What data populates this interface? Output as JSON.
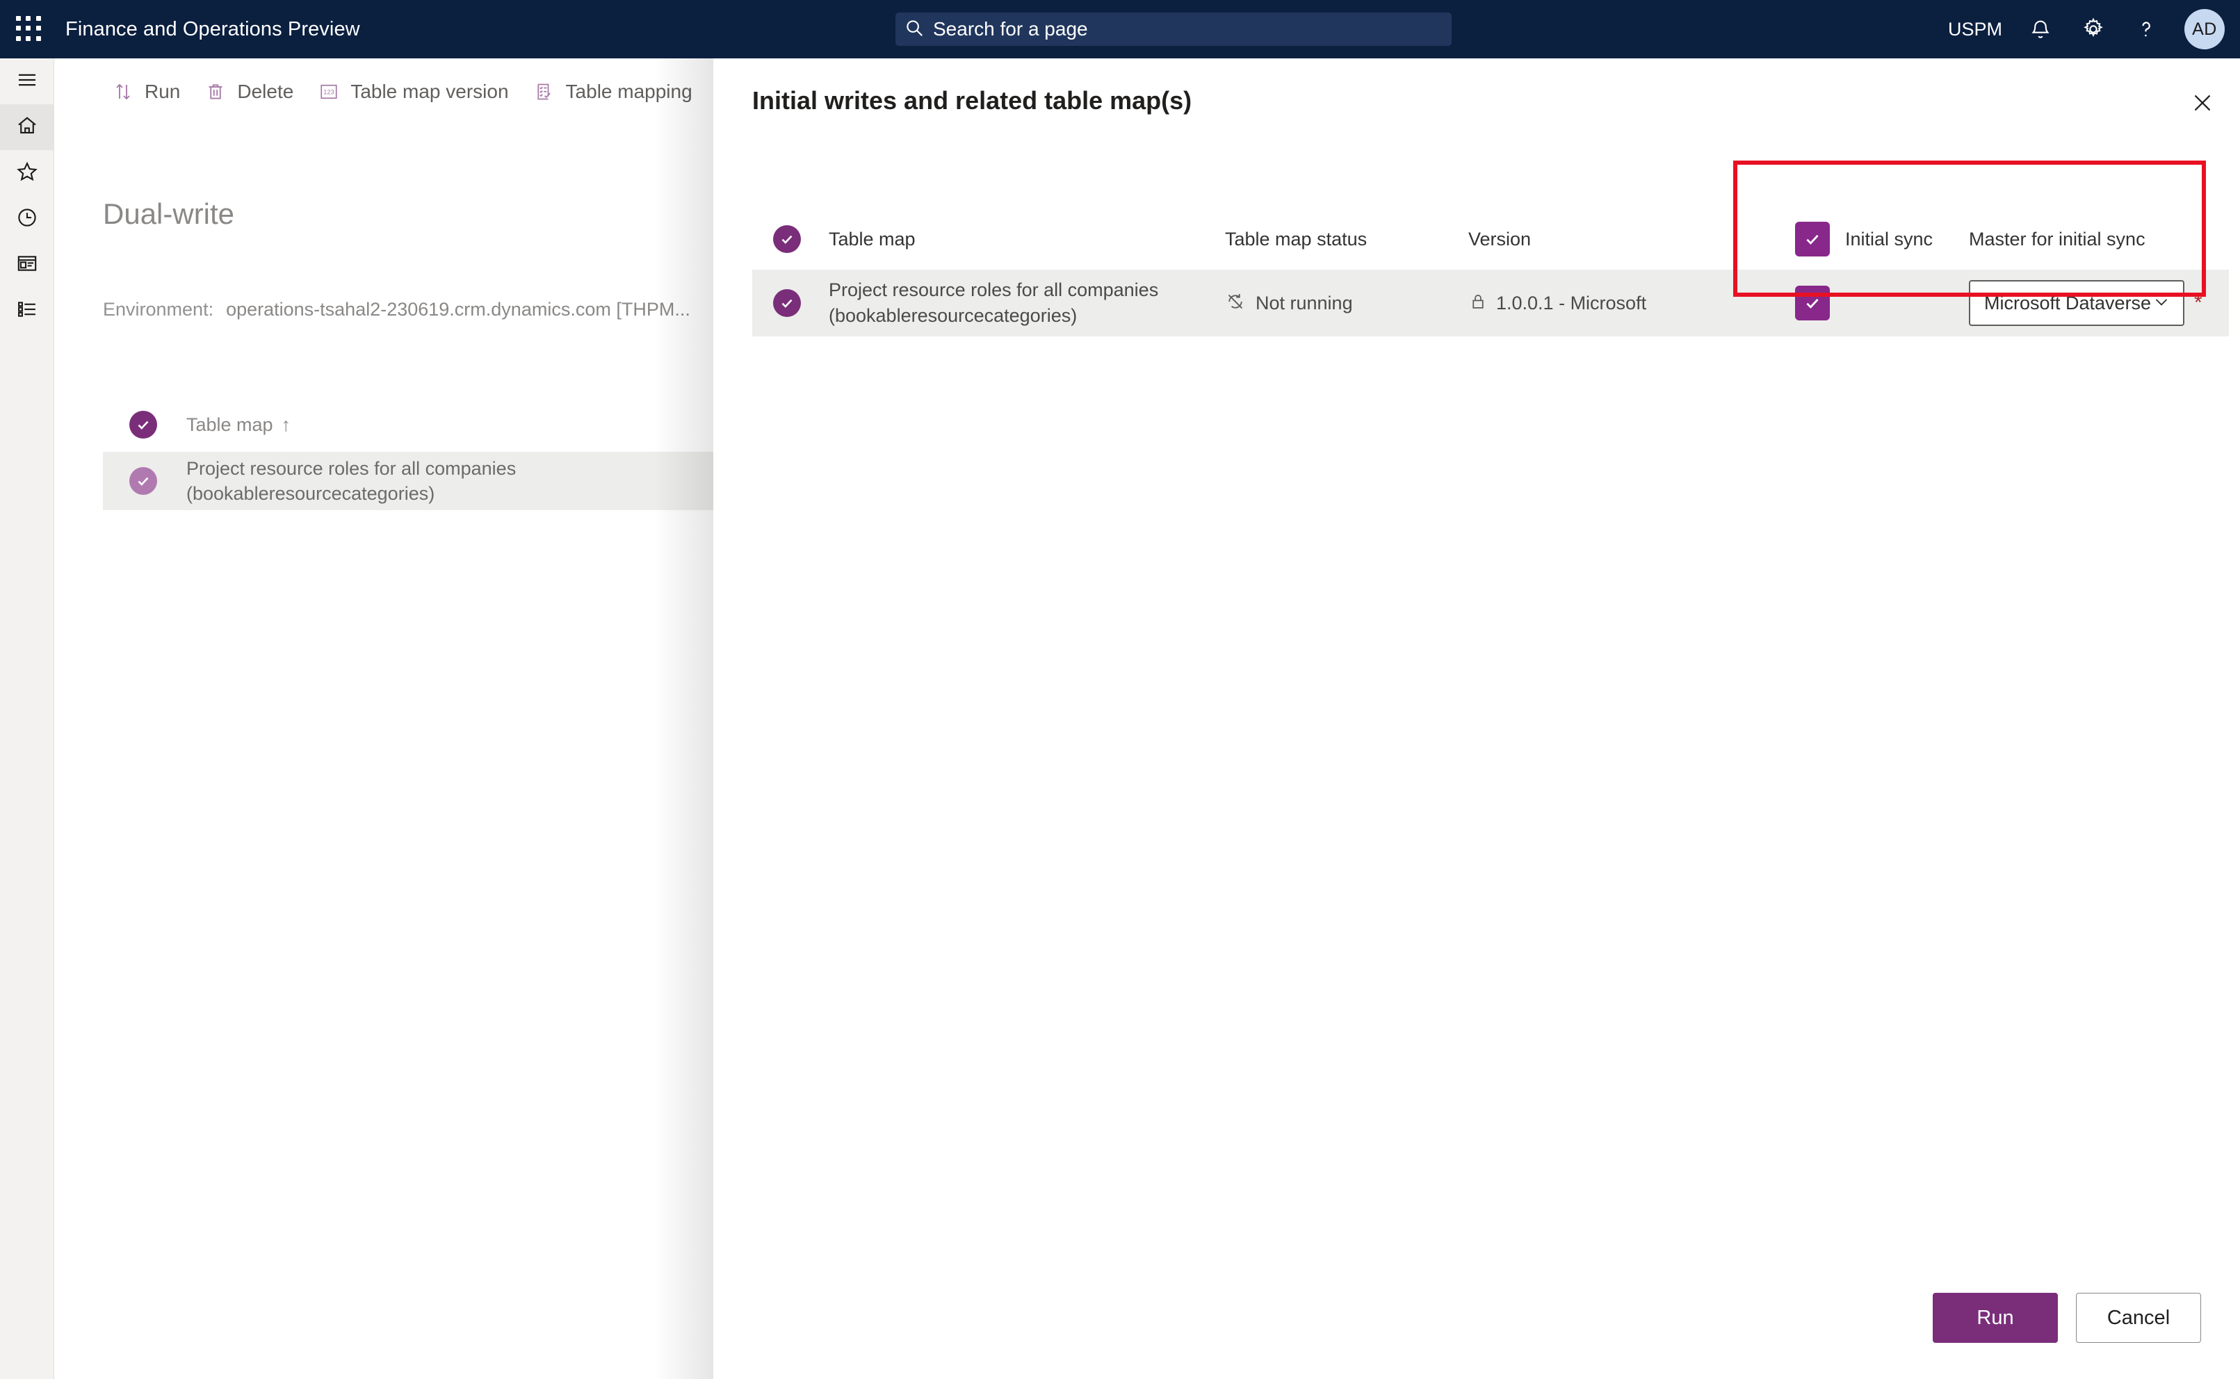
{
  "header": {
    "waffle_icon": "app-launcher-icon",
    "app_title": "Finance and Operations Preview",
    "search_placeholder": "Search for a page",
    "search_icon": "search-icon",
    "company": "USPM",
    "notifications_icon": "bell-icon",
    "settings_icon": "gear-icon",
    "help_icon": "question-mark-icon",
    "avatar_initials": "AD"
  },
  "rail": {
    "items": [
      {
        "icon": "hamburger-menu-icon",
        "name": "menu"
      },
      {
        "icon": "home-icon",
        "name": "home"
      },
      {
        "icon": "star-icon",
        "name": "favorites"
      },
      {
        "icon": "clock-icon",
        "name": "recent"
      },
      {
        "icon": "workspaces-icon",
        "name": "workspaces"
      },
      {
        "icon": "modules-list-icon",
        "name": "modules"
      }
    ]
  },
  "toolbar": {
    "items": [
      {
        "label": "Run",
        "icon": "sort-arrows-icon"
      },
      {
        "label": "Delete",
        "icon": "trash-icon"
      },
      {
        "label": "Table map version",
        "icon": "number-123-icon"
      },
      {
        "label": "Table mapping",
        "icon": "checklist-icon"
      }
    ]
  },
  "page": {
    "title": "Dual-write",
    "environment_label": "Environment:",
    "environment_value": "operations-tsahal2-230619.crm.dynamics.com [THPM..."
  },
  "table_list": {
    "header_label": "Table map",
    "sort_indicator": "↑",
    "rows": [
      {
        "line1": "Project resource roles for all companies",
        "line2": "(bookableresourcecategories)"
      }
    ]
  },
  "panel": {
    "title": "Initial writes and related table map(s)",
    "close_icon": "close-icon",
    "columns": {
      "table_map": "Table map",
      "table_map_status": "Table map status",
      "version": "Version",
      "initial_sync": "Initial sync",
      "master_for_initial_sync": "Master for initial sync"
    },
    "row": {
      "name_line1": "Project resource roles for all companies",
      "name_line2": "(bookableresourcecategories)",
      "status": "Not running",
      "status_icon": "refresh-off-icon",
      "version": "1.0.0.1 - Microsoft",
      "version_icon": "lock-icon",
      "master_value": "Microsoft Dataverse",
      "master_chevron_icon": "chevron-down-icon",
      "required_marker": "*"
    },
    "footer": {
      "run_label": "Run",
      "cancel_label": "Cancel"
    }
  },
  "colors": {
    "header_bg": "#0b1f3f",
    "accent_purple": "#7a2e7a",
    "checkbox_purple": "#87288a",
    "highlight_red": "#e81123",
    "required_red": "#a4262c",
    "row_selected_bg": "#ededeb"
  }
}
